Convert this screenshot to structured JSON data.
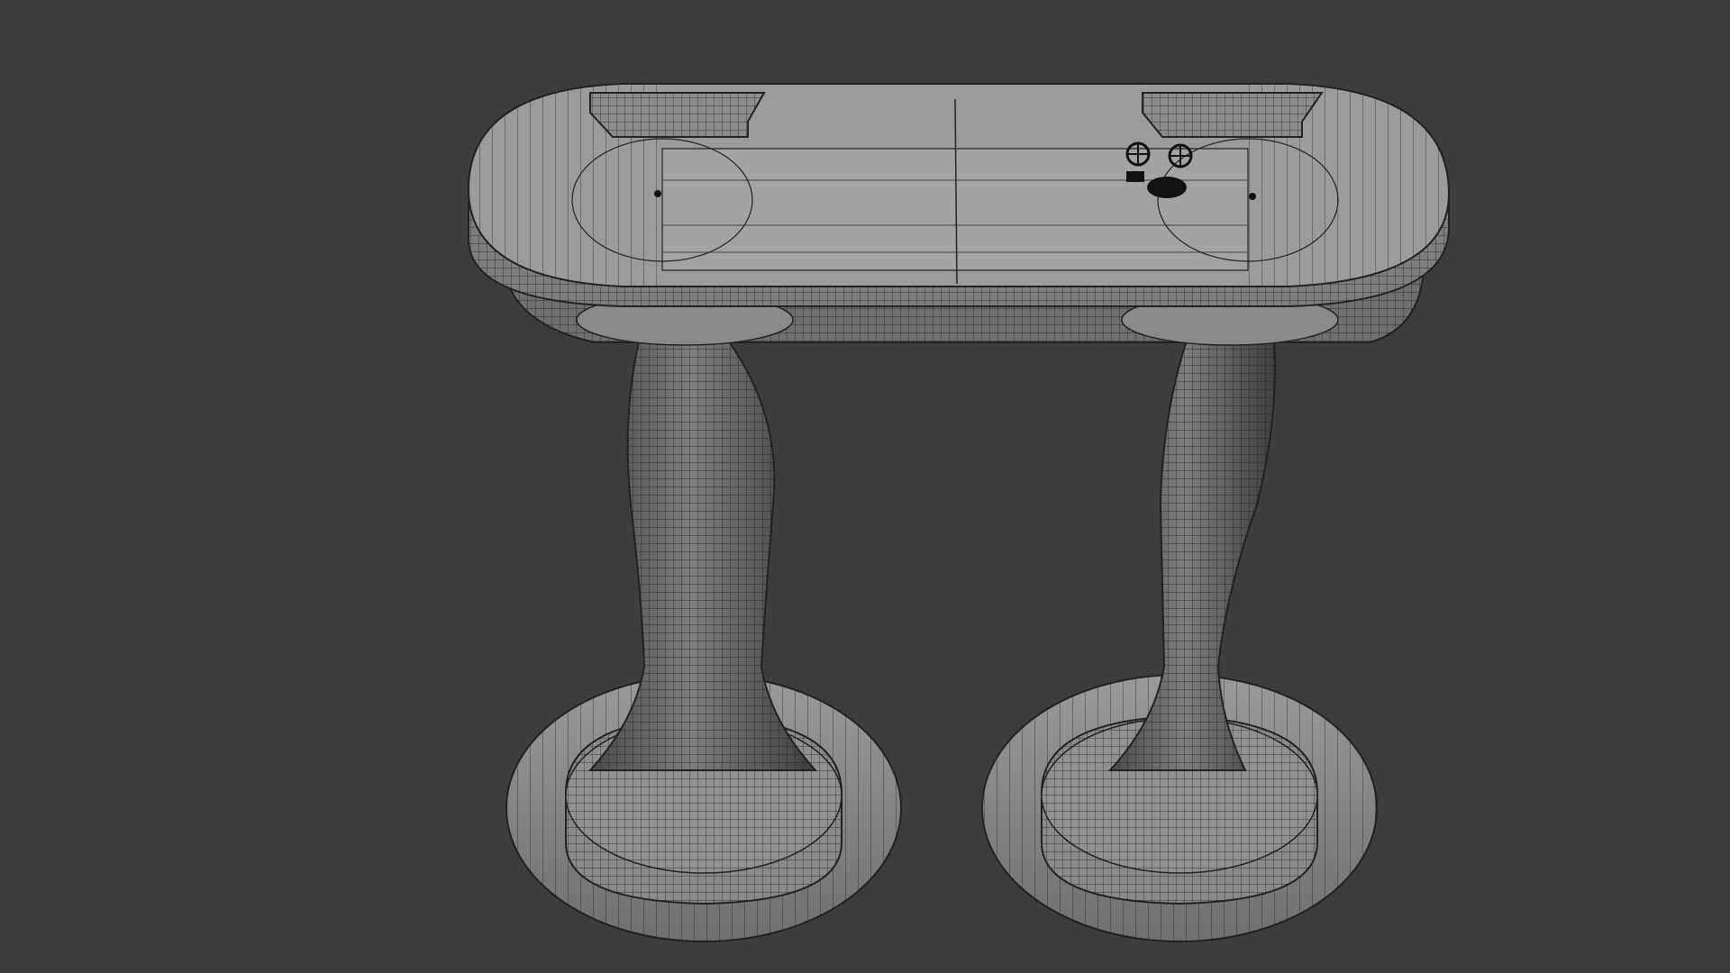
{
  "viewport": {
    "background_color": "#3d3d3d",
    "mesh_color": "#8e8e8e",
    "mesh_shade_color": "#5c5c5c",
    "wire_color": "#1c1c1c",
    "shading_mode": "wireframe-on-shaded"
  },
  "scene": {
    "objects": [
      {
        "name": "oval-tabletop",
        "icon": "mesh-icon"
      },
      {
        "name": "left-pedestal-column",
        "icon": "mesh-icon"
      },
      {
        "name": "right-pedestal-column",
        "icon": "mesh-icon"
      },
      {
        "name": "left-round-base",
        "icon": "mesh-icon"
      },
      {
        "name": "right-round-base",
        "icon": "mesh-icon"
      },
      {
        "name": "left-top-block",
        "icon": "mesh-icon"
      },
      {
        "name": "right-top-block",
        "icon": "mesh-icon"
      },
      {
        "name": "small-gear-ornament",
        "icon": "gear-icon"
      }
    ]
  }
}
